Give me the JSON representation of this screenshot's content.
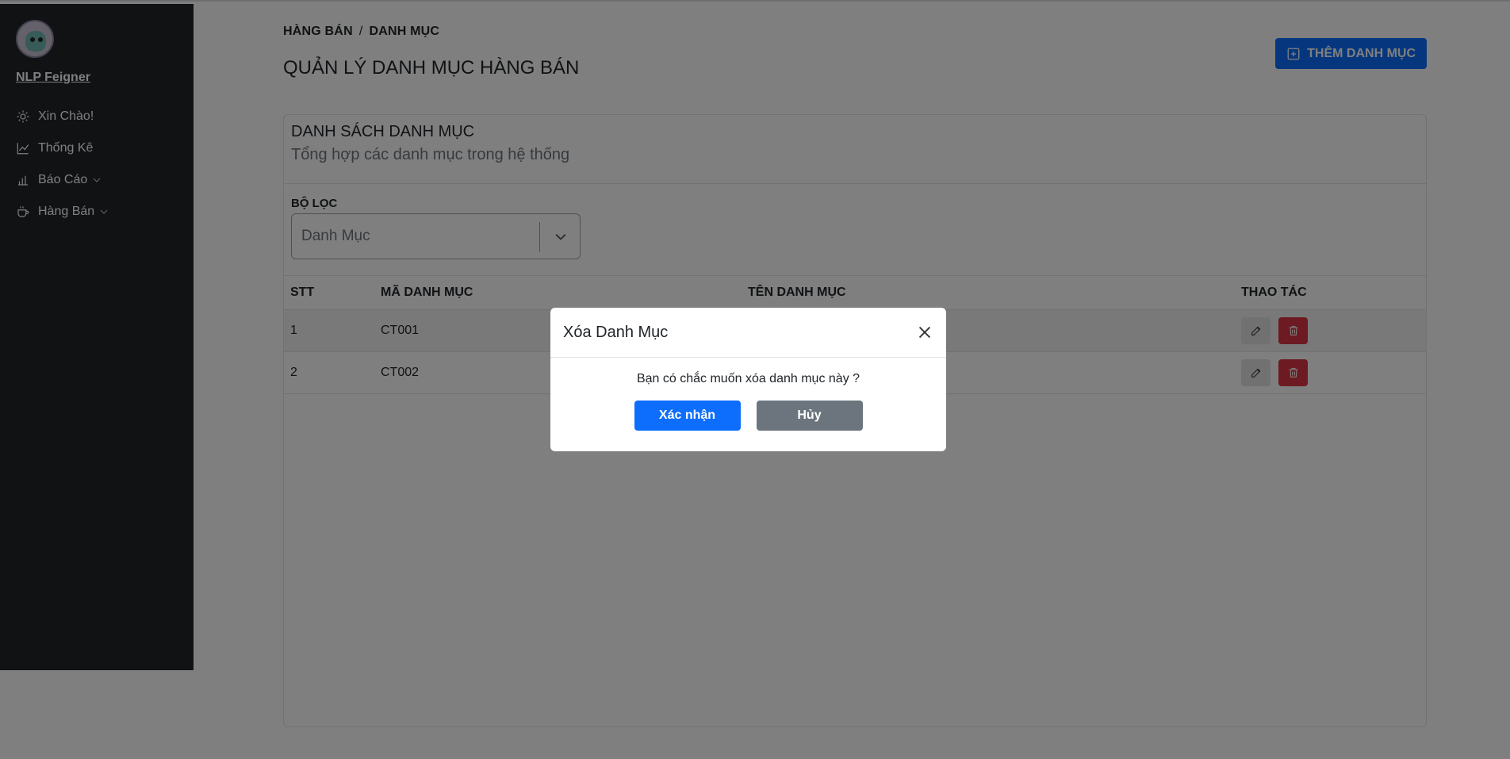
{
  "sidebar": {
    "user_name": "NLP Feigner",
    "items": [
      {
        "label": "Xin Chào!",
        "icon": "sun-icon"
      },
      {
        "label": "Thống Kê",
        "icon": "chart-line-icon"
      },
      {
        "label": "Báo Cáo",
        "icon": "bar-chart-icon",
        "has_submenu": true
      },
      {
        "label": "Hàng Bán",
        "icon": "cup-icon",
        "has_submenu": true
      }
    ]
  },
  "breadcrumb": {
    "parent": "HÀNG BÁN",
    "separator": "/",
    "current": "DANH MỤC"
  },
  "page_title": "QUẢN LÝ DANH MỤC HÀNG BÁN",
  "add_button_label": "THÊM DANH MỤC",
  "card": {
    "title": "DANH SÁCH DANH MỤC",
    "subtitle": "Tổng hợp các danh mục trong hệ thống"
  },
  "filter": {
    "label": "BỘ LỌC",
    "placeholder": "Danh Mục"
  },
  "table": {
    "columns": [
      "STT",
      "MÃ DANH MỤC",
      "TÊN DANH MỤC",
      "THAO TÁC"
    ],
    "rows": [
      {
        "stt": "1",
        "ma": "CT001",
        "ten": ""
      },
      {
        "stt": "2",
        "ma": "CT002",
        "ten": ""
      }
    ]
  },
  "modal": {
    "title": "Xóa Danh Mục",
    "message": "Bạn có chắc muốn xóa danh mục này ?",
    "confirm_label": "Xác nhận",
    "cancel_label": "Hủy"
  },
  "colors": {
    "primary": "#0d6efd",
    "danger": "#dc3545",
    "secondary": "#6c757d",
    "sidebar_bg": "#212529"
  }
}
